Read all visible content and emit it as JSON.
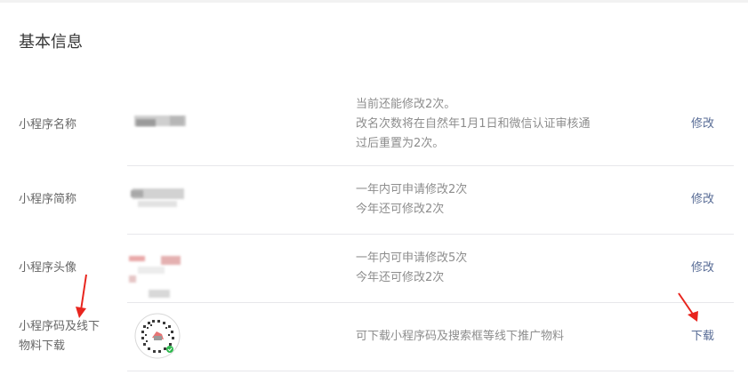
{
  "section": {
    "title": "基本信息"
  },
  "rows": [
    {
      "label": "小程序名称",
      "desc": [
        "当前还能修改2次。",
        "改名次数将在自然年1月1日和微信认证审核通",
        "过后重置为2次。"
      ],
      "action": "修改"
    },
    {
      "label": "小程序简称",
      "desc": [
        "一年内可申请修改2次",
        "今年还可修改2次"
      ],
      "action": "修改"
    },
    {
      "label": "小程序头像",
      "desc": [
        "一年内可申请修改5次",
        "今年还可修改2次"
      ],
      "action": "修改"
    },
    {
      "label_lines": [
        "小程序码及线下",
        "物料下载"
      ],
      "desc": [
        "可下载小程序码及搜索框等线下推广物料"
      ],
      "action": "下载"
    }
  ],
  "colors": {
    "link": "#576b95",
    "annotation_arrow": "#e8251e"
  },
  "icons": {
    "qr": "mini-program-code-icon",
    "arrow": "red-annotation-arrow"
  }
}
